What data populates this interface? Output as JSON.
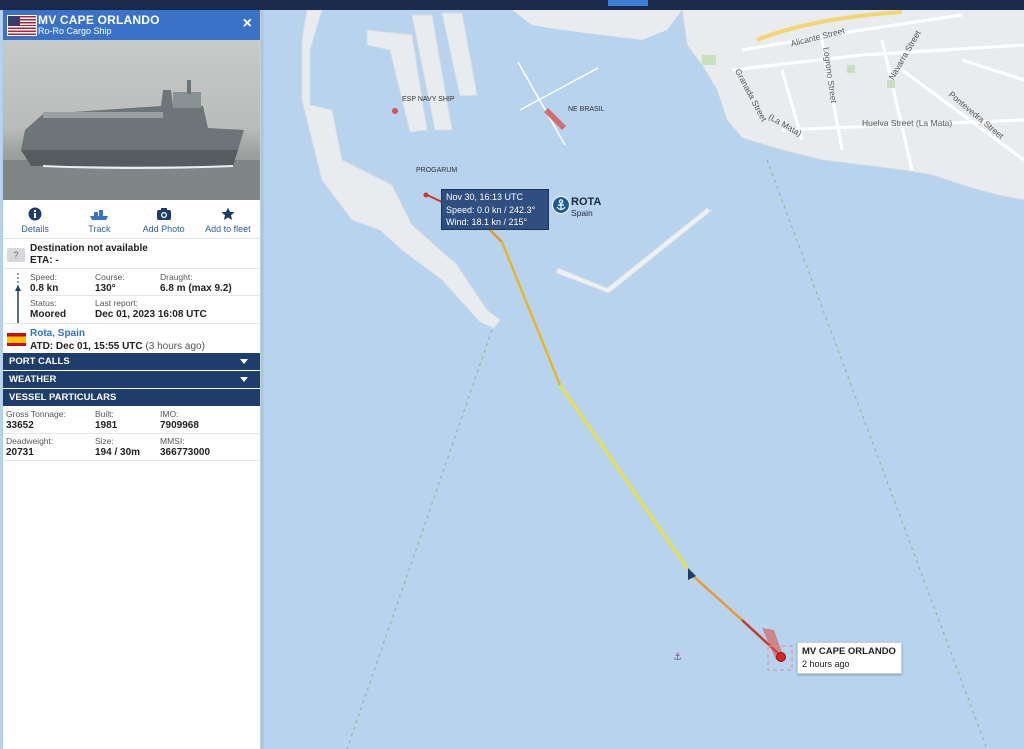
{
  "vessel": {
    "name": "MV CAPE ORLANDO",
    "type": "Ro-Ro Cargo Ship",
    "close_label": "×"
  },
  "actions": [
    {
      "label": "Details",
      "icon": "info-icon"
    },
    {
      "label": "Track",
      "icon": "ship-track-icon"
    },
    {
      "label": "Add Photo",
      "icon": "camera-icon"
    },
    {
      "label": "Add to fleet",
      "icon": "star-icon"
    }
  ],
  "voyage": {
    "destination": "Destination not available",
    "eta": "ETA: -",
    "unknown_badge": "?"
  },
  "status": {
    "speed_label": "Speed:",
    "speed": "0.8 kn",
    "course_label": "Course:",
    "course": "130°",
    "draught_label": "Draught:",
    "draught": "6.8 m (max 9.2)",
    "status_label": "Status:",
    "status": "Moored",
    "last_report_label": "Last report:",
    "last_report": "Dec 01, 2023 16:08 UTC"
  },
  "last_port": {
    "name": "Rota, Spain",
    "atd": "ATD: Dec 01, 15:55 UTC",
    "atd_ago": "(3 hours ago)"
  },
  "sections": {
    "port_calls": "PORT CALLS",
    "weather": "WEATHER",
    "particulars": "VESSEL PARTICULARS"
  },
  "particulars": {
    "gross_tonnage_label": "Gross Tonnage:",
    "gross_tonnage": "33652",
    "built_label": "Built:",
    "built": "1981",
    "imo_label": "IMO:",
    "imo": "7909968",
    "deadweight_label": "Deadweight:",
    "deadweight": "20731",
    "size_label": "Size:",
    "size": "194 / 30m",
    "mmsi_label": "MMSI:",
    "mmsi": "366773000"
  },
  "track_popup": {
    "time": "Nov 30, 16:13 UTC",
    "speed": "Speed: 0.0 kn / 242.3°",
    "wind": "Wind: 18.1 kn / 215°"
  },
  "port": {
    "name": "ROTA",
    "country": "Spain"
  },
  "map_labels": {
    "esp_navy_ship": "ESP NAVY SHIP",
    "ne_brasil": "NE BRASIL",
    "progarum": "PROGARUM"
  },
  "streets": {
    "alicante": "Alicante Street",
    "granada": "Granada Street",
    "logrono": "Logrono Street",
    "navarra": "Navarra Street",
    "la_mata": "(La Mata)",
    "huelva": "Huelva Street (La Mata)",
    "pontevedra": "Pontevedra Street"
  },
  "ship_tag": {
    "name": "MV CAPE ORLANDO",
    "ago": "2 hours ago"
  },
  "colors": {
    "header": "#3a72c8",
    "section_bar": "#1e3d6b",
    "sea": "#b7d3ee",
    "land": "#e8ebee",
    "track_yellow": "#f0e22e",
    "track_orange": "#e89a2e",
    "track_red": "#c73a2a"
  }
}
